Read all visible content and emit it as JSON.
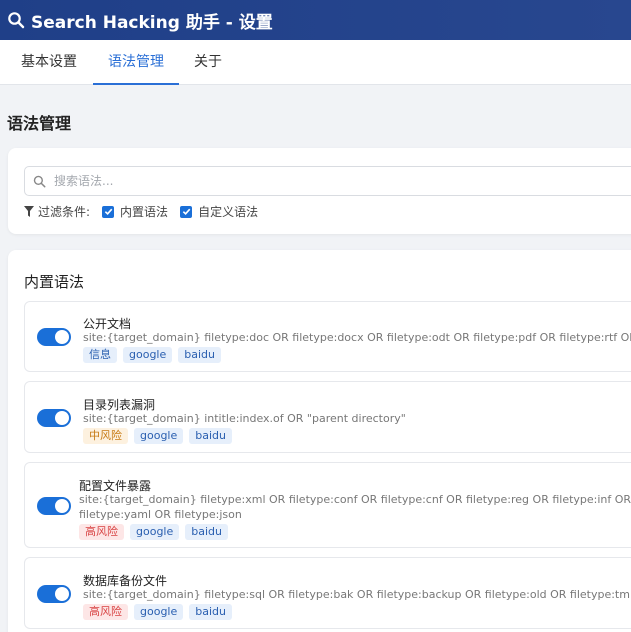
{
  "window": {
    "title": "Search Hacking 助手 - 设置"
  },
  "tabs": [
    {
      "label": "基本设置"
    },
    {
      "label": "语法管理"
    },
    {
      "label": "关于"
    }
  ],
  "active_tab": "语法管理",
  "page": {
    "title": "语法管理"
  },
  "filter": {
    "search_placeholder": "搜索语法...",
    "filter_label": "过滤条件:",
    "builtin_label": "内置语法",
    "builtin_checked": true,
    "custom_label": "自定义语法",
    "custom_checked": true
  },
  "builtin": {
    "title": "内置语法",
    "items": [
      {
        "name": "公开文档",
        "query": "site:{target_domain} filetype:doc OR filetype:docx OR filetype:odt OR filetype:pdf OR filetype:rtf OR filetype:sxw OR fi",
        "query2": "",
        "risk": "信息",
        "engines": [
          "google",
          "baidu"
        ],
        "enabled": true
      },
      {
        "name": "目录列表漏洞",
        "query": "site:{target_domain} intitle:index.of OR \"parent directory\"",
        "query2": "",
        "risk": "中风险",
        "engines": [
          "google",
          "baidu"
        ],
        "enabled": true
      },
      {
        "name": "配置文件暴露",
        "query": "site:{target_domain} filetype:xml OR filetype:conf OR filetype:cnf OR filetype:reg OR filetype:inf OR filetype:rdp OR file",
        "query2": "filetype:yaml OR filetype:json",
        "risk": "高风险",
        "engines": [
          "google",
          "baidu"
        ],
        "enabled": true
      },
      {
        "name": "数据库备份文件",
        "query": "site:{target_domain} filetype:sql OR filetype:bak OR filetype:backup OR filetype:old OR filetype:tmp",
        "query2": "",
        "risk": "高风险",
        "engines": [
          "google",
          "baidu"
        ],
        "enabled": true
      }
    ]
  },
  "colors": {
    "header": "#1f3f88",
    "accent": "#1a6fd8",
    "risk_info": "#2a5fb0",
    "risk_mid": "#c77a14",
    "risk_high": "#d84444"
  }
}
